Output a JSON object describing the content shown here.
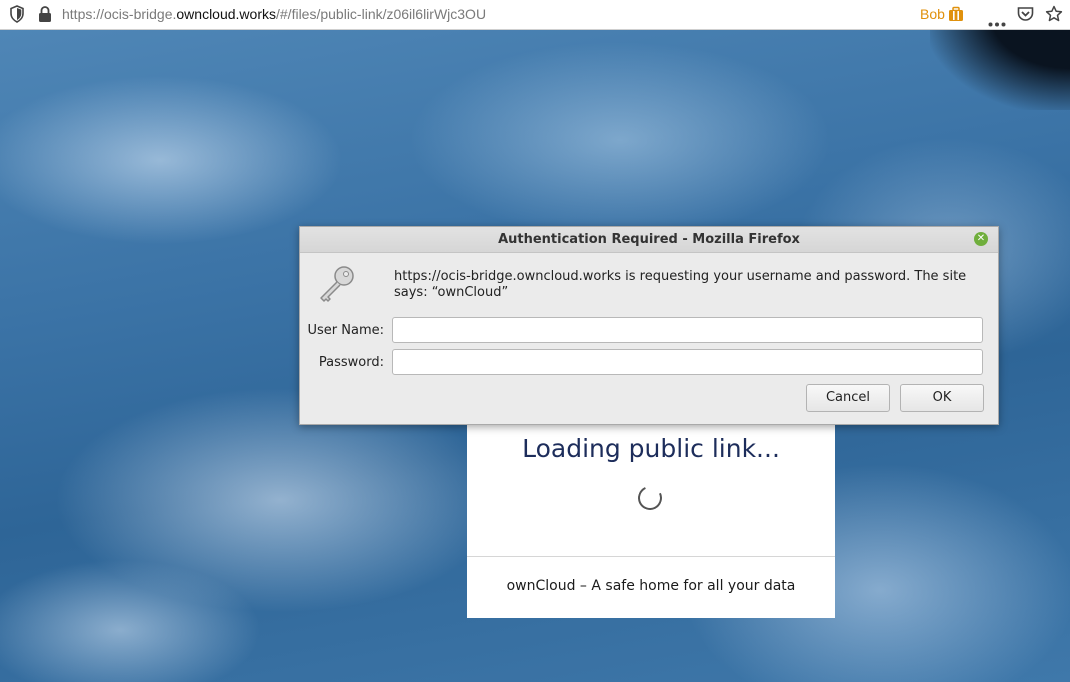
{
  "browser": {
    "url_prefix": "https://ocis-bridge.",
    "url_domain": "owncloud.works",
    "url_suffix": "/#/files/public-link/z06il6lirWjc3OU",
    "user_label": "Bob",
    "icons": [
      "shield-icon",
      "lock-icon",
      "briefcase-icon",
      "more-icon",
      "pocket-icon",
      "bookmark-star-icon"
    ]
  },
  "page": {
    "loading_title": "Loading public link...",
    "footer": "ownCloud – A safe home for all your data"
  },
  "dialog": {
    "title": "Authentication Required - Mozilla Firefox",
    "message": "https://ocis-bridge.owncloud.works is requesting your username and password. The site says: “ownCloud”",
    "username_label": "User Name:",
    "username_value": "",
    "password_label": "Password:",
    "password_value": "",
    "cancel_label": "Cancel",
    "ok_label": "OK"
  },
  "colors": {
    "accent_user": "#e0910d",
    "title_text": "#1d2d5b",
    "close_green": "#6fae3c"
  }
}
